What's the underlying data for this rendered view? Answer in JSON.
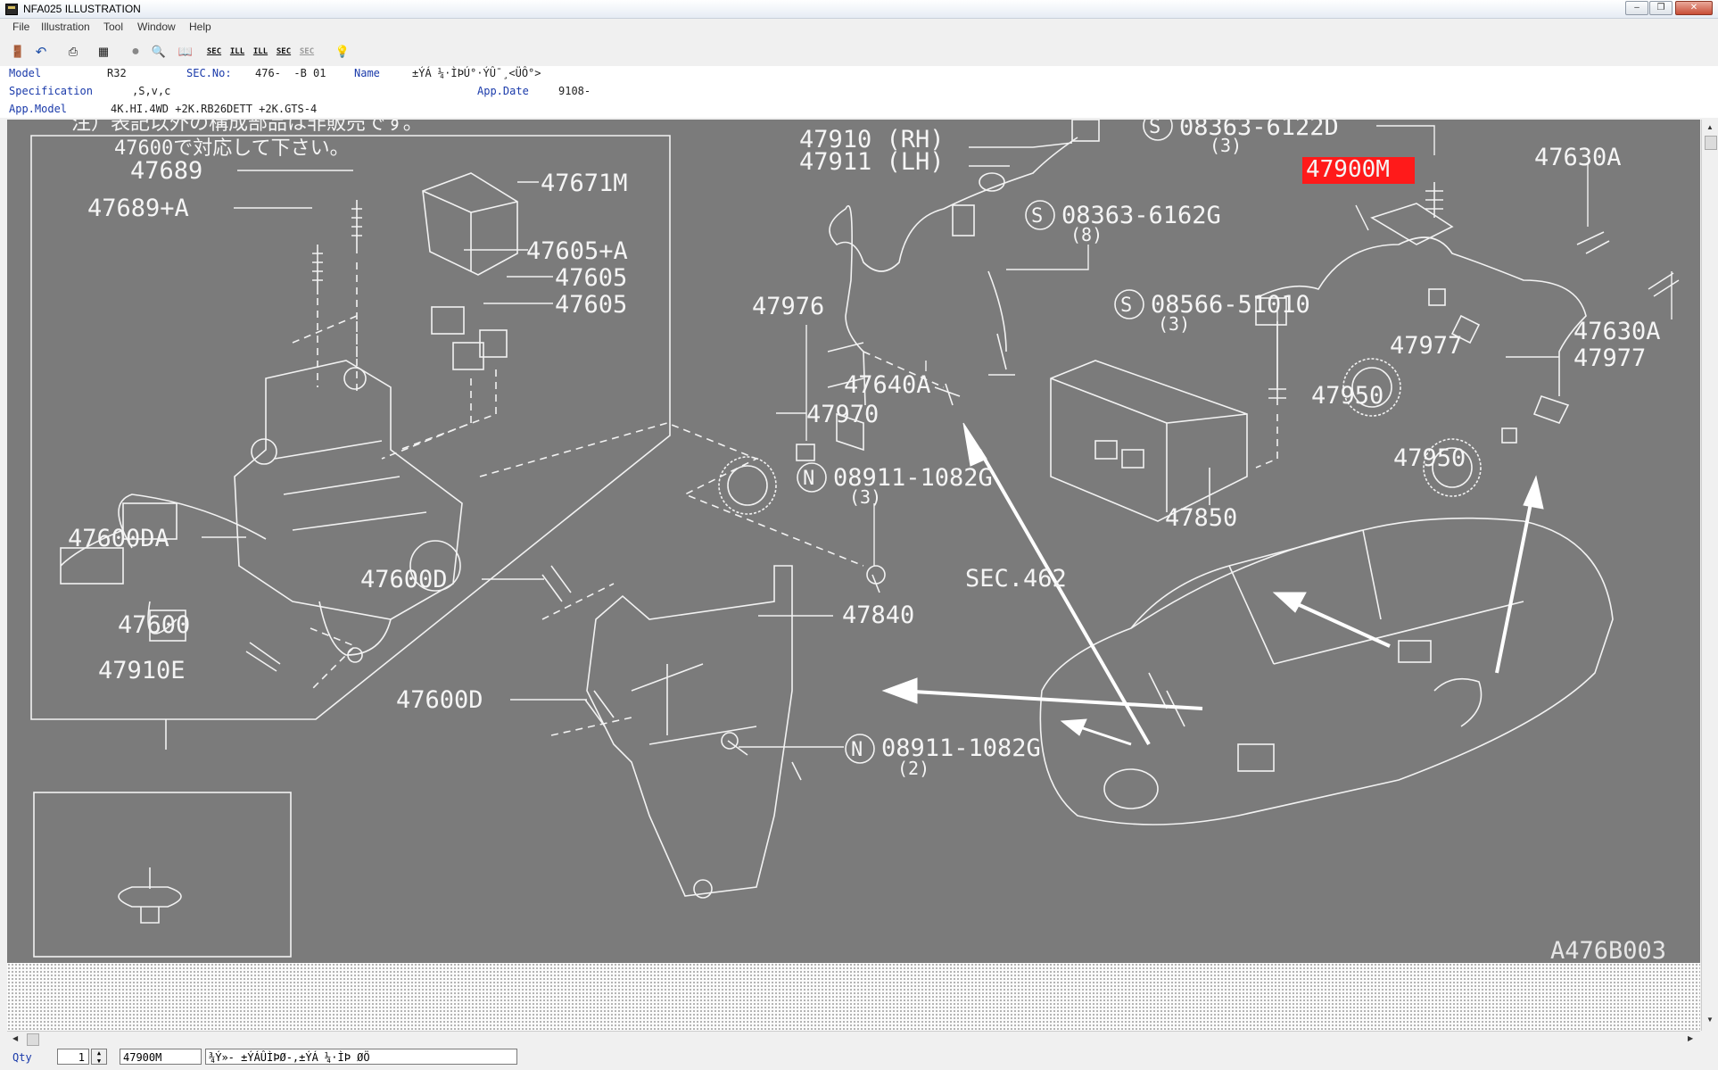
{
  "window": {
    "title": "NFA025  ILLUSTRATION",
    "controls": {
      "minimize": "‒",
      "maximize": "❐",
      "close": "✕"
    }
  },
  "menu": [
    "File",
    "Illustration",
    "Tool",
    "Window",
    "Help"
  ],
  "toolbar": {
    "buttons": [
      {
        "name": "exit",
        "icon": "exit-door-icon"
      },
      {
        "name": "undo",
        "icon": "undo-icon"
      },
      {
        "name": "print",
        "icon": "printer-icon"
      },
      {
        "name": "catalog",
        "icon": "catalog-icon"
      },
      {
        "name": "circle",
        "icon": "circle-icon"
      },
      {
        "name": "zoom",
        "icon": "magnifier-icon"
      },
      {
        "name": "book",
        "icon": "book-icon"
      },
      {
        "name": "sec1",
        "icon": "sec-icon",
        "label": "SEC"
      },
      {
        "name": "ill1",
        "icon": "ill-icon",
        "label": "ILL"
      },
      {
        "name": "ill2",
        "icon": "ill-icon",
        "label": "ILL"
      },
      {
        "name": "sec2",
        "icon": "sec-icon",
        "label": "SEC"
      },
      {
        "name": "sec3",
        "icon": "sec-disabled-icon",
        "label": "SEC"
      },
      {
        "name": "help",
        "icon": "hint-icon"
      }
    ]
  },
  "info": {
    "model_label": "Model",
    "model": "R32",
    "secno_label": "SEC.No:",
    "secno": "476-  -B 01",
    "name_label": "Name",
    "name": "±ÝÁ ¼·ÌÞÚ°·ÝÛ¯¸<ÜÔ°>",
    "spec_label": "Specification",
    "spec": ",S,v,c",
    "appdate_label": "App.Date",
    "appdate": "9108-",
    "appmodel_label": "App.Model",
    "appmodel": "4K.HI.4WD +2K.RB26DETT +2K.GTS-4"
  },
  "illustration": {
    "note_line1": "注）表記以外の構成部品は非販売です。",
    "note_line2": "47600で対応して下さい。",
    "figure_id": "A476B003",
    "highlight_color": "#ff1a1a",
    "labels": {
      "p47689": "47689",
      "p47689a": "47689+A",
      "p47671m": "47671M",
      "p47605a": "47605+A",
      "p47605_1": "47605",
      "p47605_2": "47605",
      "p47600da": "47600DA",
      "p47600": "47600",
      "p47910e": "47910E",
      "p47910": "47910 (RH)",
      "p47911": "47911 (LH)",
      "p47976": "47976",
      "p47640a": "47640A",
      "p47970": "47970",
      "s1": "08363-6162G",
      "s1q": "(8)",
      "s2": "08363-6122D",
      "s2q": "(3)",
      "p47900m": "47900M",
      "p47630a_1": "47630A",
      "p47630a_2": "47630A",
      "p47977_1": "47977",
      "p47977_2": "47977",
      "p47950_1": "47950",
      "p47950_2": "47950",
      "s3": "08566-51010",
      "s3q": "(3)",
      "p47850": "47850",
      "n1": "08911-1082G",
      "n1q": "(3)",
      "sec462": "SEC.462",
      "p47840": "47840",
      "p47600d_1": "47600D",
      "p47600d_2": "47600D",
      "n2": "08911-1082G",
      "n2q": "(2)",
      "s_mark": "S",
      "n_mark": "N"
    }
  },
  "status": {
    "qty_label": "Qty",
    "qty": "1",
    "part_no": "47900M",
    "part_name": "¾Ý»- ±ÝÁÛÌÞØ-,±ÝÁ ¼·ÌÞ ØÖ"
  }
}
